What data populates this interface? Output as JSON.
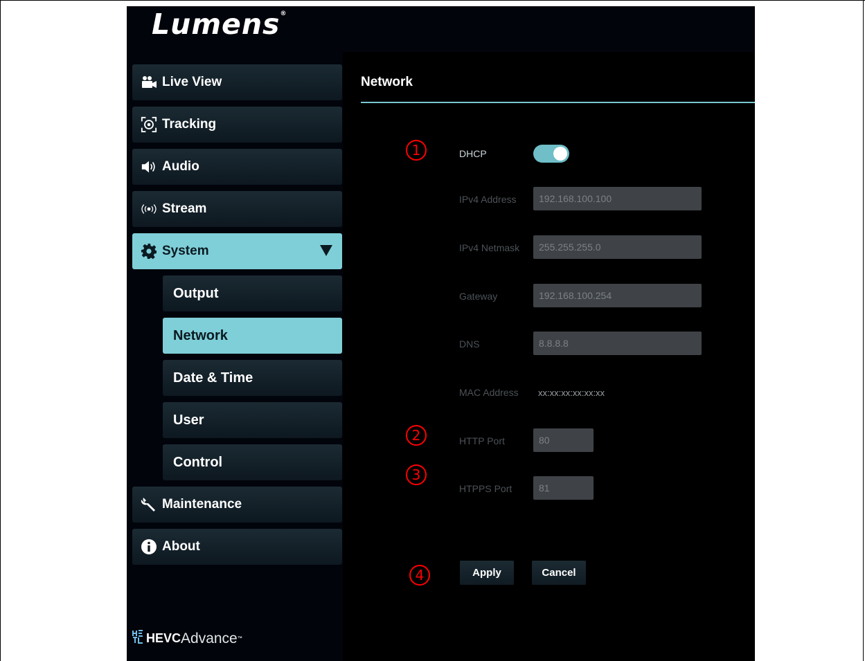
{
  "brand": {
    "logo_text": "Lumens",
    "logo_mark": "®"
  },
  "sidebar": {
    "items": [
      {
        "label": "Live View",
        "icon": "video-camera-icon"
      },
      {
        "label": "Tracking",
        "icon": "tracking-target-icon"
      },
      {
        "label": "Audio",
        "icon": "speaker-icon"
      },
      {
        "label": "Stream",
        "icon": "broadcast-icon"
      },
      {
        "label": "System",
        "icon": "gear-icon",
        "expanded": true
      },
      {
        "label": "Maintenance",
        "icon": "wrench-icon"
      },
      {
        "label": "About",
        "icon": "info-icon"
      }
    ],
    "system_sub": [
      {
        "label": "Output"
      },
      {
        "label": "Network",
        "active": true
      },
      {
        "label": "Date & Time"
      },
      {
        "label": "User"
      },
      {
        "label": "Control"
      }
    ],
    "footer": {
      "bold": "HEVC",
      "light": "Advance",
      "tm": "™"
    }
  },
  "page": {
    "title": "Network",
    "dhcp_label": "DHCP",
    "dhcp_enabled": true,
    "fields": {
      "ipv4_address": {
        "label": "IPv4 Address",
        "value": "192.168.100.100"
      },
      "ipv4_netmask": {
        "label": "IPv4 Netmask",
        "value": "255.255.255.0"
      },
      "gateway": {
        "label": "Gateway",
        "value": "192.168.100.254"
      },
      "dns": {
        "label": "DNS",
        "value": "8.8.8.8"
      },
      "mac_address": {
        "label": "MAC Address",
        "value": "xx:xx:xx:xx:xx:xx"
      },
      "http_port": {
        "label": "HTTP Port",
        "value": "80"
      },
      "https_port": {
        "label": "HTPPS Port",
        "value": "81"
      }
    },
    "apply_label": "Apply",
    "cancel_label": "Cancel"
  },
  "annotations": [
    "1",
    "2",
    "3",
    "4"
  ],
  "colors": {
    "accent": "#7fcfd8",
    "background": "#02040b",
    "annotation": "#ff0000"
  }
}
